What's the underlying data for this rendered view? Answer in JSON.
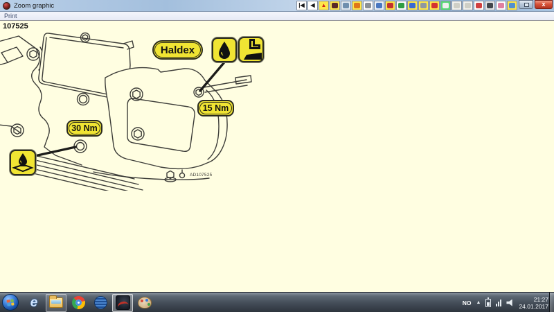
{
  "window": {
    "title": "Zoom graphic",
    "menu_print": "Print",
    "close_glyph": "x"
  },
  "toolbar": {
    "icons": [
      {
        "name": "nav-first-icon",
        "bg": "#ffffff",
        "glyph": "|◀",
        "color": "#1a1a1a"
      },
      {
        "name": "nav-back-icon",
        "bg": "#ffffff",
        "glyph": "◀",
        "color": "#1a1a1a"
      },
      {
        "name": "warning-icon",
        "bg": "#ffe84a",
        "glyph": "▲",
        "color": "#d42313"
      },
      {
        "name": "graphic-icon",
        "bg": "#ffe84a",
        "tile": "#5a2a28"
      },
      {
        "name": "tools-icon",
        "bg": "#dfe9f2",
        "tile": "#6f8fae"
      },
      {
        "name": "timer-icon",
        "bg": "#ffe84a",
        "tile": "#e07818"
      },
      {
        "name": "tire-icon",
        "bg": "#ffffff",
        "tile": "#8a9096"
      },
      {
        "name": "diagnostics-icon",
        "bg": "#eaf2fa",
        "tile": "#4a78c0"
      },
      {
        "name": "wiring-icon",
        "bg": "#ffe84a",
        "tile": "#c23230"
      },
      {
        "name": "lift-icon",
        "bg": "#ffffff",
        "tile": "#2f9e44"
      },
      {
        "name": "machine-icon",
        "bg": "#ffe84a",
        "tile": "#3a6ad4"
      },
      {
        "name": "tool-icon",
        "bg": "#ffe84a",
        "tile": "#8f98a0"
      },
      {
        "name": "vehicle-red-icon",
        "bg": "#ffe84a",
        "tile": "#d43430"
      },
      {
        "name": "printer-icon",
        "bg": "#58d878",
        "tile": "#f0f0f0"
      },
      {
        "name": "disabled-icon-1",
        "bg": "#f2f2ee",
        "tile": "#cfcfc6"
      },
      {
        "name": "disabled-icon-2",
        "bg": "#f2f2ee",
        "tile": "#cfcfc6"
      },
      {
        "name": "seat-icon",
        "bg": "#ffffff",
        "tile": "#d04040"
      },
      {
        "name": "steering-icon",
        "bg": "#e4e6e8",
        "tile": "#42464c"
      },
      {
        "name": "airbag-icon",
        "bg": "#ffffff",
        "tile": "#e080a0"
      },
      {
        "name": "vehicle-blue-icon",
        "bg": "#ffe84a",
        "tile": "#5090d0"
      }
    ]
  },
  "graphic": {
    "code": "107525",
    "drawing_ref": "AD107525",
    "labels": {
      "haldex": "Haldex",
      "torque_fill": "15 Nm",
      "torque_drain": "30 Nm"
    },
    "colors": {
      "canvas": "#FFFEE1",
      "label_yellow": "#F0E433",
      "label_border": "#2B2B1E",
      "line": "#3C3C38"
    }
  },
  "taskbar": {
    "tray": {
      "language": "NO",
      "hidden_icons_glyph": "▲",
      "clock_time": "21:27",
      "clock_date": "24.01.2017"
    }
  }
}
